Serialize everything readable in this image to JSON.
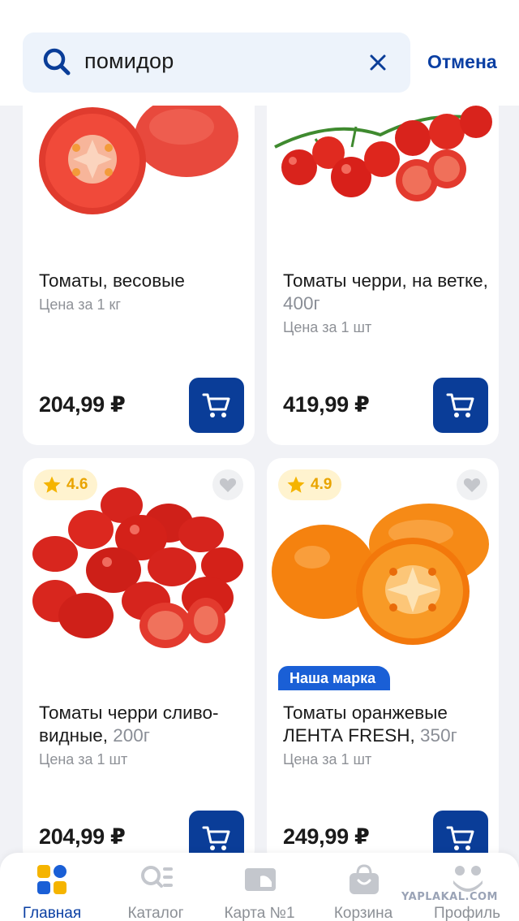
{
  "search": {
    "query": "помидор",
    "cancel_label": "Отмена"
  },
  "products": [
    {
      "title": "Томаты, весовые",
      "weight": "",
      "unit": "Цена за 1 кг",
      "price": "204,99 ₽",
      "image": "tomato-halves-image"
    },
    {
      "title": "Томаты черри, на ветке, ",
      "weight": "400г",
      "unit": "Цена за 1 шт",
      "price": "419,99 ₽",
      "image": "cherry-vine-image"
    },
    {
      "title": "Томаты черри сливо-видные, ",
      "weight": "200г",
      "unit": "Цена за 1 шт",
      "price": "204,99 ₽",
      "rating": "4.6",
      "image": "plum-cherry-image"
    },
    {
      "title": "Томаты оранжевые ЛЕНТА FRESH, ",
      "weight": "350г",
      "unit": "Цена за 1 шт",
      "price": "249,99 ₽",
      "rating": "4.9",
      "badge": "Наша марка",
      "image": "orange-tomato-image"
    }
  ],
  "nav": {
    "items": [
      {
        "label": "Главная",
        "icon": "home-tiles-icon",
        "active": true
      },
      {
        "label": "Каталог",
        "icon": "catalog-icon",
        "active": false
      },
      {
        "label": "Карта №1",
        "icon": "loyalty-card-icon",
        "active": false
      },
      {
        "label": "Корзина",
        "icon": "basket-icon",
        "active": false
      },
      {
        "label": "Профиль",
        "icon": "profile-icon",
        "active": false
      }
    ]
  },
  "watermark": "YAPLAKAL.COM",
  "colors": {
    "accent": "#0a3d98",
    "link": "#0a3fa3",
    "rating": "#e9a400",
    "badge": "#1a5fd6"
  }
}
